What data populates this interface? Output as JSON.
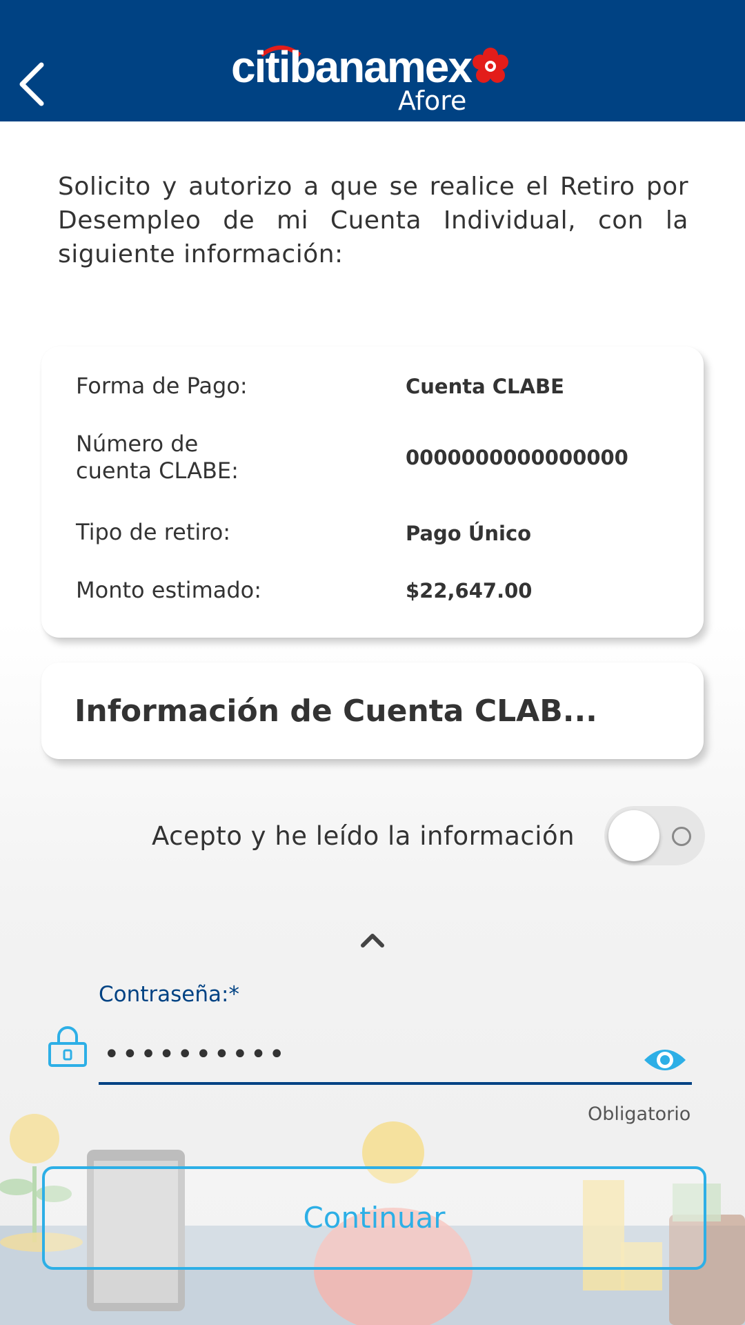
{
  "header": {
    "brand_name": "citibanamex",
    "brand_sub": "Afore",
    "back_icon": "chevron-left-icon",
    "colors": {
      "background": "#004283",
      "flower": "#e31d1a"
    }
  },
  "intro_text": "Solicito y autorizo a que se realice el Retiro por Desempleo de mi Cuenta Individual, con la siguiente información:",
  "summary": {
    "rows": [
      {
        "label": "Forma de Pago:",
        "value": "Cuenta CLABE"
      },
      {
        "label_line1": "Número de",
        "label_line2": "cuenta CLABE:",
        "value": "0000000000000000"
      },
      {
        "label": "Tipo de retiro:",
        "value": "Pago Único"
      },
      {
        "label": "Monto estimado:",
        "value": "$22,647.00"
      }
    ]
  },
  "clabe_card": {
    "title": "Información de Cuenta CLAB..."
  },
  "acceptance": {
    "label": "Acepto y he leído la información",
    "toggle_on": false
  },
  "password": {
    "label": "Contraseña:*",
    "value": "••••••••••",
    "required_text": "Obligatorio",
    "lock_icon": "lock-icon",
    "eye_icon": "eye-icon",
    "accent_color": "#004283"
  },
  "actions": {
    "continue_label": "Continuar",
    "button_color": "#2dafe6"
  }
}
